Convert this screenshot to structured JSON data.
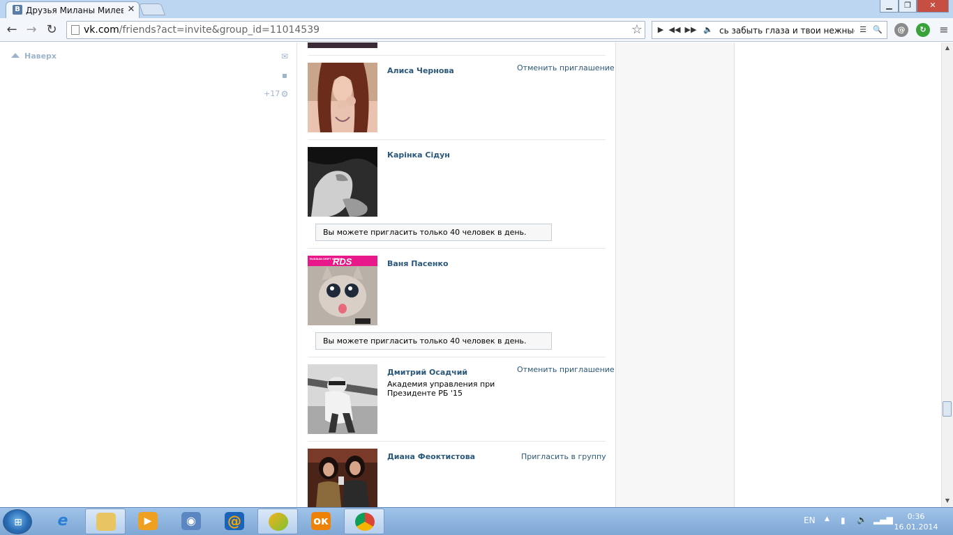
{
  "browser": {
    "tab_title": "Друзья Миланы Милевс",
    "tab_favicon_letter": "В",
    "url_host": "vk.com",
    "url_path": "/friends?act=invite&group_id=11014539"
  },
  "player": {
    "now_playing": "сь забыть глаза и твои нежные по"
  },
  "left_panel": {
    "up_label": "Наверх",
    "counter": "+17"
  },
  "friends": [
    {
      "name": "Алиса Чернова",
      "action": "Отменить приглашение",
      "info": "",
      "notice": ""
    },
    {
      "name": "Карінка Сідун",
      "action": "",
      "info": "",
      "notice": "Вы можете пригласить только 40 человек в день."
    },
    {
      "name": "Ваня Пасенко",
      "action": "",
      "info": "",
      "notice": "Вы можете пригласить только 40 человек в день."
    },
    {
      "name": "Дмитрий Осадчий",
      "action": "Отменить приглашение",
      "info": "Академия управления при Президенте РБ '15",
      "notice": ""
    },
    {
      "name": "Диана Феоктистова",
      "action": "Пригласить в группу",
      "info": "",
      "notice": ""
    }
  ],
  "photo_text": {
    "rds_small": "RUSSIAN DRIFT SERIES",
    "rds_logo": "RDS"
  },
  "taskbar": {
    "language": "EN",
    "time": "0:36",
    "date": "16.01.2014"
  },
  "colors": {
    "link": "#2b587a",
    "taskbar": "#8fb5df",
    "titlebar": "#bcd6f1"
  }
}
